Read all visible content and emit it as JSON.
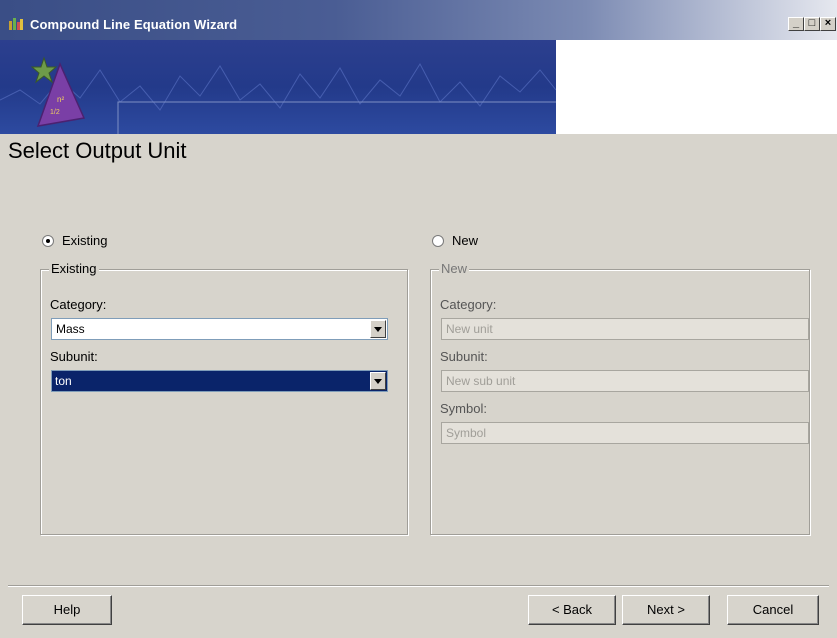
{
  "window": {
    "title": "Compound Line Equation Wizard",
    "controls": [
      "minimize",
      "maximize",
      "close"
    ],
    "app_icon": "wizard-app-icon",
    "banner_icon": "wizard-hat-icon"
  },
  "page": {
    "title": "Select Output Unit"
  },
  "mode": {
    "selected": "existing"
  },
  "existing": {
    "radio_label": "Existing",
    "group_title": "Existing",
    "category_label": "Category:",
    "category_value": "Mass",
    "subunit_label": "Subunit:",
    "subunit_value": "ton"
  },
  "new": {
    "radio_label": "New",
    "group_title": "New",
    "category_label": "Category:",
    "category_placeholder": "New unit",
    "subunit_label": "Subunit:",
    "subunit_placeholder": "New sub unit",
    "symbol_label": "Symbol:",
    "symbol_placeholder": "Symbol"
  },
  "buttons": {
    "help": "Help",
    "back": "< Back",
    "next": "Next >",
    "cancel": "Cancel"
  },
  "colors": {
    "titlebar": "#3a4e86",
    "banner": "#233a8a",
    "face": "#d7d4cc",
    "selection": "#0a246a"
  }
}
